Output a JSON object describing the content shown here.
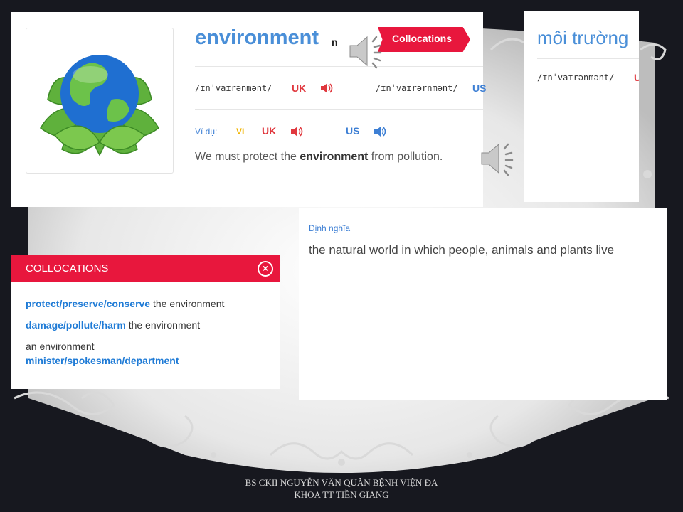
{
  "entry": {
    "word": "environment",
    "pos": "n",
    "collocations_button": "Collocations",
    "ipa_uk": "/ɪnˈvaɪrənmənt/",
    "uk": "UK",
    "ipa_us": "/ɪnˈvaɪrərnmənt/",
    "us": "US",
    "example_label": "Ví dụ:",
    "vi_label": "VI",
    "example_before": "We must protect the ",
    "example_bold": "environment",
    "example_after": " from pollution."
  },
  "translation": {
    "word": "môi trường",
    "ipa": "/ɪnˈvaɪrənmənt/",
    "uk": "U"
  },
  "definition": {
    "label": "Định nghĩa",
    "text": "the natural world in which people, animals and plants live"
  },
  "collocations": {
    "title": "COLLOCATIONS",
    "items": [
      {
        "kw": "protect/preserve/conserve",
        "rest": " the environment"
      },
      {
        "kw": "damage/pollute/harm",
        "rest": " the environment"
      },
      {
        "pre": "an environment",
        "kw": "minister/spokesman/department"
      }
    ]
  },
  "footer": {
    "line1": "BS CKII NGUYỄN VĂN QUÂN BỆNH VIỆN ĐA",
    "line2": "KHOA TT TIỀN GIANG"
  },
  "colors": {
    "accent": "#e8173d",
    "link": "#1f7bd6",
    "word": "#4a8fd8",
    "uk": "#e0383e"
  }
}
